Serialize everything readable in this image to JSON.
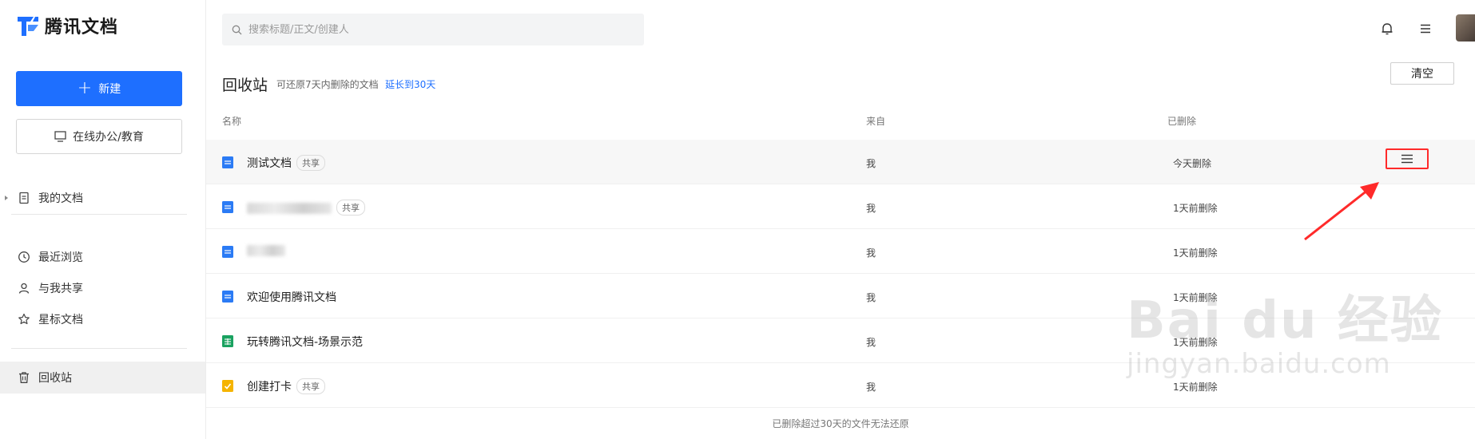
{
  "app": {
    "name": "腾讯文档"
  },
  "sidebar": {
    "new_label": "新建",
    "office_label": "在线办公/教育",
    "items": [
      {
        "label": "我的文档"
      },
      {
        "label": "最近浏览"
      },
      {
        "label": "与我共享"
      },
      {
        "label": "星标文档"
      },
      {
        "label": "回收站"
      }
    ]
  },
  "search": {
    "placeholder": "搜索标题/正文/创建人"
  },
  "page": {
    "title": "回收站",
    "hint": "可还原7天内删除的文档",
    "extend_link": "延长到30天",
    "clear_label": "清空",
    "footer": "已删除超过30天的文件无法还原"
  },
  "table": {
    "headers": {
      "name": "名称",
      "from": "来自",
      "deleted": "已删除"
    },
    "rows": [
      {
        "name": "测试文档",
        "badge": "共享",
        "from": "我",
        "deleted": "今天删除",
        "type": "doc"
      },
      {
        "name": "",
        "badge": "共享",
        "from": "我",
        "deleted": "1天前删除",
        "type": "doc"
      },
      {
        "name": "",
        "badge": "",
        "from": "我",
        "deleted": "1天前删除",
        "type": "doc"
      },
      {
        "name": "欢迎使用腾讯文档",
        "badge": "",
        "from": "我",
        "deleted": "1天前删除",
        "type": "doc"
      },
      {
        "name": "玩转腾讯文档-场景示范",
        "badge": "",
        "from": "我",
        "deleted": "1天前删除",
        "type": "sheet"
      },
      {
        "name": "创建打卡",
        "badge": "共享",
        "from": "我",
        "deleted": "1天前删除",
        "type": "checkin"
      }
    ]
  },
  "watermark": {
    "main": "Bai du 经验",
    "sub": "jingyan.baidu.com"
  },
  "colors": {
    "primary": "#1e6fff",
    "highlight": "#ff2a2a",
    "doc": "#2b7bf5",
    "sheet": "#1aa260",
    "checkin": "#f5b400"
  }
}
